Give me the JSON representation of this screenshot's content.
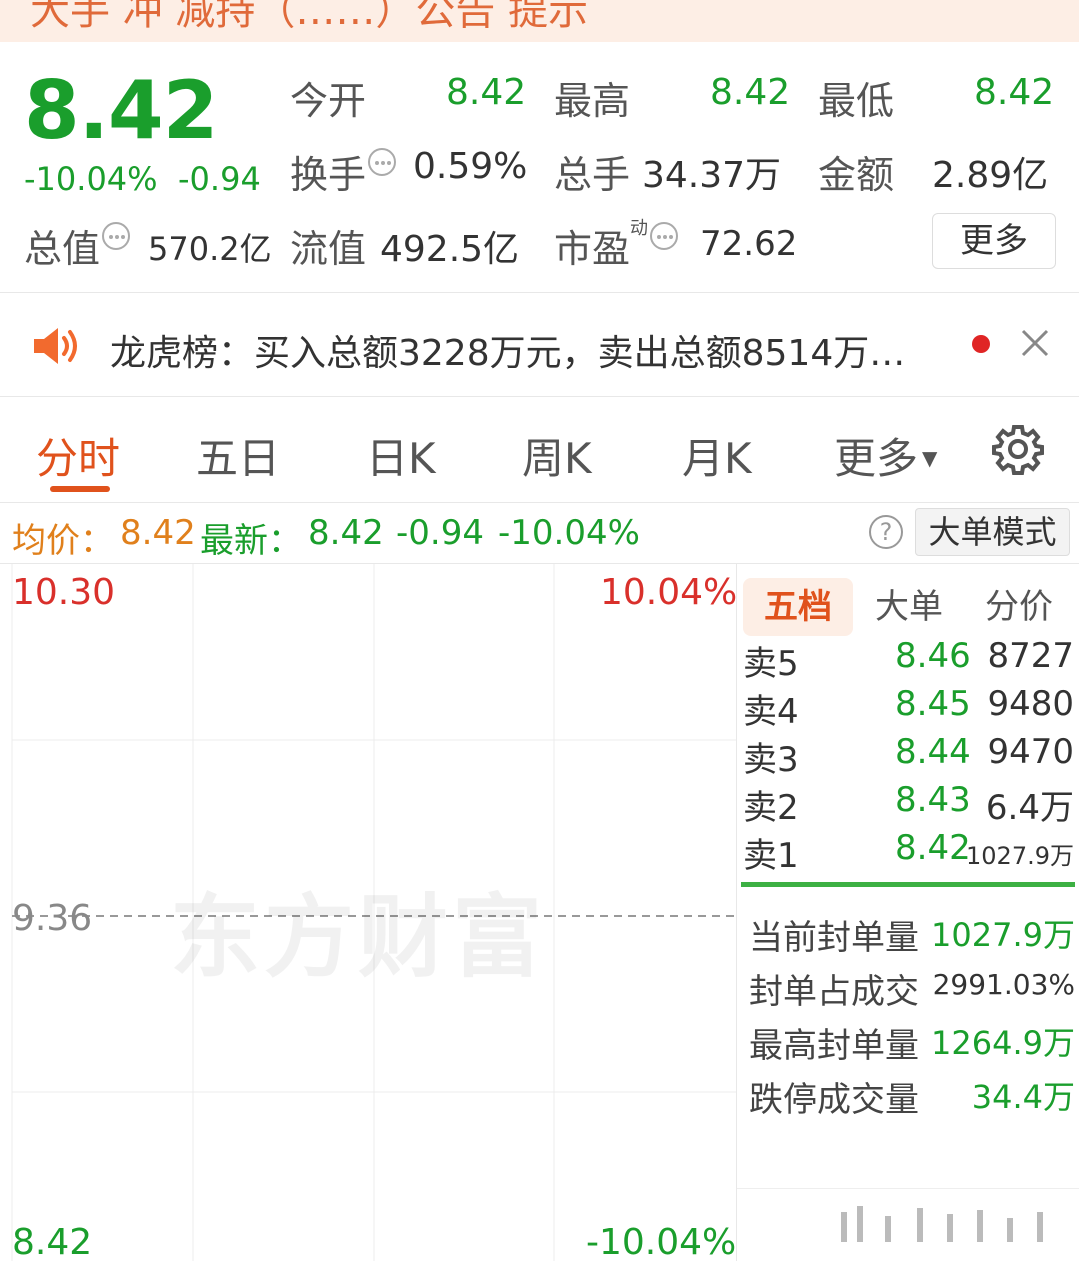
{
  "top_banner": {
    "text": "大手 冲 减持（……）公告 提示"
  },
  "quote": {
    "price": "8.42",
    "pct_change": "-10.04%",
    "abs_change": "-0.94",
    "open_label": "今开",
    "open_value": "8.42",
    "high_label": "最高",
    "high_value": "8.42",
    "low_label": "最低",
    "low_value": "8.42",
    "turnover_label": "换手",
    "turnover_value": "0.59%",
    "volume_label": "总手",
    "volume_value": "34.37万",
    "amount_label": "金额",
    "amount_value": "2.89亿",
    "mktcap_label": "总值",
    "mktcap_value": "570.2亿",
    "float_label": "流值",
    "float_value": "492.5亿",
    "pe_label": "市盈",
    "pe_superscript": "动",
    "pe_value": "72.62",
    "more_label": "更多"
  },
  "notice": {
    "text": "龙虎榜：买入总额3228万元，卖出总额8514万…"
  },
  "tabs": [
    {
      "label": "分时",
      "active": true
    },
    {
      "label": "五日"
    },
    {
      "label": "日K"
    },
    {
      "label": "周K"
    },
    {
      "label": "月K"
    },
    {
      "label": "更多"
    }
  ],
  "avg_row": {
    "avg_label": "均价：",
    "avg_value": "8.42",
    "latest_label": "最新：",
    "latest_value": "8.42",
    "change": "-0.94",
    "pct": "-10.04%",
    "help": "?",
    "mode_button": "大单模式"
  },
  "chart": {
    "top_price": "10.30",
    "top_pct": "10.04%",
    "mid_price": "9.36",
    "bottom_price": "8.42",
    "bottom_pct": "-10.04%",
    "watermark": "东方财富"
  },
  "order_book": {
    "tabs": [
      "五档",
      "大单",
      "分价"
    ],
    "rows": [
      {
        "label": "卖5",
        "price": "8.46",
        "volume": "8727"
      },
      {
        "label": "卖4",
        "price": "8.45",
        "volume": "9480"
      },
      {
        "label": "卖3",
        "price": "8.44",
        "volume": "9470"
      },
      {
        "label": "卖2",
        "price": "8.43",
        "volume": "6.4万"
      },
      {
        "label": "卖1",
        "price": "8.42",
        "volume": "1027.9万"
      }
    ],
    "seal": [
      {
        "label": "当前封单量",
        "value": "1027.9万",
        "color": "#1a9e2c"
      },
      {
        "label": "封单占成交",
        "value": "2991.03%",
        "color": "#333333"
      },
      {
        "label": "最高封单量",
        "value": "1264.9万",
        "color": "#1a9e2c"
      },
      {
        "label": "跌停成交量",
        "value": "34.4万",
        "color": "#1a9e2c"
      }
    ]
  },
  "colors": {
    "down": "#1a9e2c",
    "up": "#d9302b",
    "accent": "#e0521c",
    "avg": "#e0801c"
  }
}
